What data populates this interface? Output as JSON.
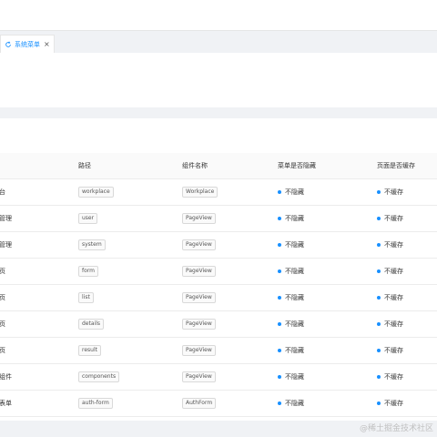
{
  "tabs": [
    {
      "label": "系统菜单",
      "icon": "refresh-icon",
      "close": "×"
    }
  ],
  "table": {
    "columns": [
      "称",
      "路径",
      "组件名称",
      "菜单是否隐藏",
      "页面是否缓存"
    ],
    "rows": [
      {
        "name": "作台",
        "path": "workplace",
        "component": "Workplace",
        "hidden": "不隐藏",
        "cache": "不缓存"
      },
      {
        "name": "户管理",
        "path": "user",
        "component": "PageView",
        "hidden": "不隐藏",
        "cache": "不缓存"
      },
      {
        "name": "统管理",
        "path": "system",
        "component": "PageView",
        "hidden": "不隐藏",
        "cache": "不缓存"
      },
      {
        "name": "单页",
        "path": "form",
        "component": "PageView",
        "hidden": "不隐藏",
        "cache": "不缓存"
      },
      {
        "name": "表页",
        "path": "list",
        "component": "PageView",
        "hidden": "不隐藏",
        "cache": "不缓存"
      },
      {
        "name": "情页",
        "path": "details",
        "component": "PageView",
        "hidden": "不隐藏",
        "cache": "不缓存"
      },
      {
        "name": "果页",
        "path": "result",
        "component": "PageView",
        "hidden": "不隐藏",
        "cache": "不缓存"
      },
      {
        "name": "置组件",
        "path": "components",
        "component": "PageView",
        "hidden": "不隐藏",
        "cache": "不缓存"
      },
      {
        "name": "权表单",
        "path": "auth-form",
        "component": "AuthForm",
        "hidden": "不隐藏",
        "cache": "不缓存"
      }
    ],
    "status_color": "#1890ff"
  },
  "watermark": "@稀土掘金技术社区",
  "colors": {
    "accent": "#1890ff",
    "background": "#f0f2f5"
  }
}
